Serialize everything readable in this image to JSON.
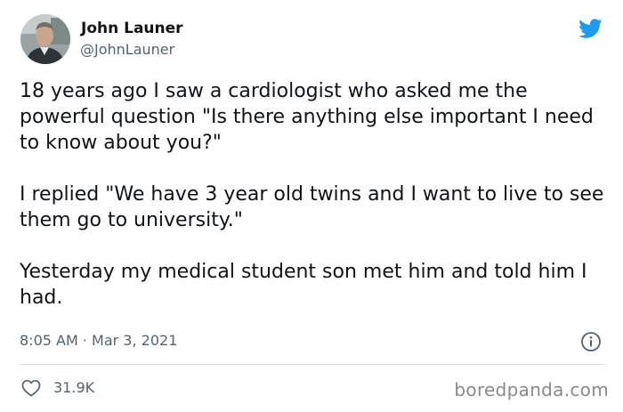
{
  "author": {
    "display_name": "John Launer",
    "handle": "@JohnLauner"
  },
  "tweet": {
    "paragraphs": [
      "18 years ago I saw a cardiologist who asked me the powerful question \"Is there anything else important I need to know about you?\"",
      "I replied \"We have 3 year old twins and I want to live to see them go to university.\"",
      "Yesterday my medical student son met him and told him I had."
    ],
    "timestamp": "8:05 AM · Mar 3, 2021",
    "like_count": "31.9K"
  },
  "icons": {
    "platform": "twitter-bird-icon",
    "info": "info-icon",
    "like": "heart-icon"
  },
  "colors": {
    "brand": "#1d9bf0",
    "text_primary": "#0f1419",
    "text_secondary": "#536471",
    "divider": "#cfd9de"
  },
  "watermark": "boredpanda.com"
}
